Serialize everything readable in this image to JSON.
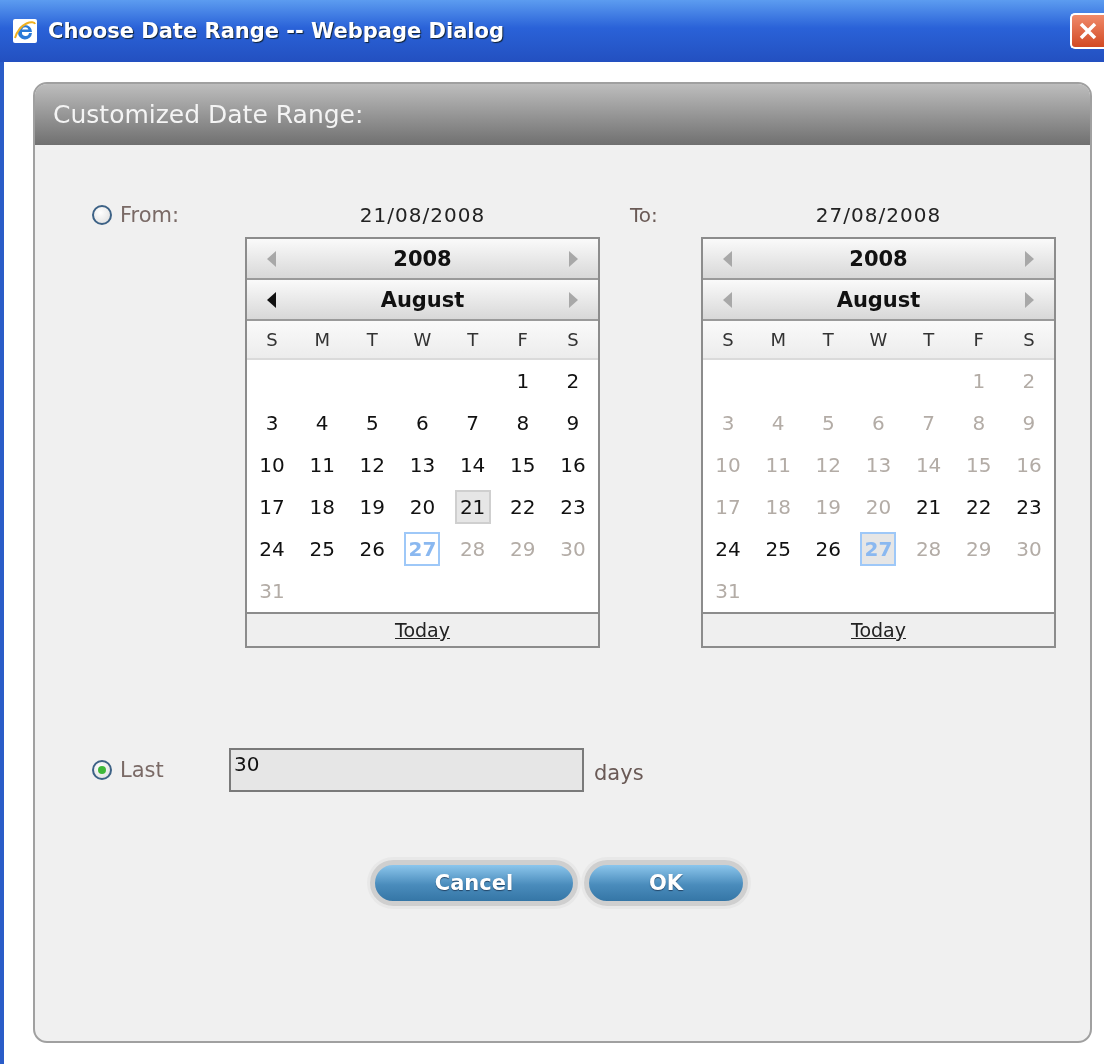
{
  "window": {
    "title": "Choose Date Range -- Webpage Dialog"
  },
  "panel": {
    "title": "Customized Date Range:"
  },
  "range": {
    "from_option": {
      "label": "From:",
      "selected": false
    },
    "to_label": "To:",
    "calendars": [
      {
        "date": "21/08/2008",
        "year": "2008",
        "year_prev_enabled": false,
        "year_next_enabled": false,
        "month": "August",
        "month_prev_enabled": true,
        "month_next_enabled": false,
        "weekdays": [
          "S",
          "M",
          "T",
          "W",
          "T",
          "F",
          "S"
        ],
        "today_link": "Today",
        "weeks": [
          [
            {
              "kind": "blank"
            },
            {
              "kind": "blank"
            },
            {
              "kind": "blank"
            },
            {
              "kind": "blank"
            },
            {
              "kind": "blank"
            },
            {
              "kind": "day",
              "text": "1",
              "enabled": true,
              "selected": false,
              "today": false
            },
            {
              "kind": "day",
              "text": "2",
              "enabled": true,
              "selected": false,
              "today": false
            }
          ],
          [
            {
              "kind": "day",
              "text": "3",
              "enabled": true,
              "selected": false,
              "today": false
            },
            {
              "kind": "day",
              "text": "4",
              "enabled": true,
              "selected": false,
              "today": false
            },
            {
              "kind": "day",
              "text": "5",
              "enabled": true,
              "selected": false,
              "today": false
            },
            {
              "kind": "day",
              "text": "6",
              "enabled": true,
              "selected": false,
              "today": false
            },
            {
              "kind": "day",
              "text": "7",
              "enabled": true,
              "selected": false,
              "today": false
            },
            {
              "kind": "day",
              "text": "8",
              "enabled": true,
              "selected": false,
              "today": false
            },
            {
              "kind": "day",
              "text": "9",
              "enabled": true,
              "selected": false,
              "today": false
            }
          ],
          [
            {
              "kind": "day",
              "text": "10",
              "enabled": true,
              "selected": false,
              "today": false
            },
            {
              "kind": "day",
              "text": "11",
              "enabled": true,
              "selected": false,
              "today": false
            },
            {
              "kind": "day",
              "text": "12",
              "enabled": true,
              "selected": false,
              "today": false
            },
            {
              "kind": "day",
              "text": "13",
              "enabled": true,
              "selected": false,
              "today": false
            },
            {
              "kind": "day",
              "text": "14",
              "enabled": true,
              "selected": false,
              "today": false
            },
            {
              "kind": "day",
              "text": "15",
              "enabled": true,
              "selected": false,
              "today": false
            },
            {
              "kind": "day",
              "text": "16",
              "enabled": true,
              "selected": false,
              "today": false
            }
          ],
          [
            {
              "kind": "day",
              "text": "17",
              "enabled": true,
              "selected": false,
              "today": false
            },
            {
              "kind": "day",
              "text": "18",
              "enabled": true,
              "selected": false,
              "today": false
            },
            {
              "kind": "day",
              "text": "19",
              "enabled": true,
              "selected": false,
              "today": false
            },
            {
              "kind": "day",
              "text": "20",
              "enabled": true,
              "selected": false,
              "today": false
            },
            {
              "kind": "day",
              "text": "21",
              "enabled": true,
              "selected": true,
              "today": false
            },
            {
              "kind": "day",
              "text": "22",
              "enabled": true,
              "selected": false,
              "today": false
            },
            {
              "kind": "day",
              "text": "23",
              "enabled": true,
              "selected": false,
              "today": false
            }
          ],
          [
            {
              "kind": "day",
              "text": "24",
              "enabled": true,
              "selected": false,
              "today": false
            },
            {
              "kind": "day",
              "text": "25",
              "enabled": true,
              "selected": false,
              "today": false
            },
            {
              "kind": "day",
              "text": "26",
              "enabled": true,
              "selected": false,
              "today": false
            },
            {
              "kind": "day",
              "text": "27",
              "enabled": true,
              "selected": false,
              "today": true
            },
            {
              "kind": "day",
              "text": "28",
              "enabled": false,
              "selected": false,
              "today": false
            },
            {
              "kind": "day",
              "text": "29",
              "enabled": false,
              "selected": false,
              "today": false
            },
            {
              "kind": "day",
              "text": "30",
              "enabled": false,
              "selected": false,
              "today": false
            }
          ],
          [
            {
              "kind": "day",
              "text": "31",
              "enabled": false,
              "selected": false,
              "today": false
            }
          ]
        ]
      },
      {
        "date": "27/08/2008",
        "year": "2008",
        "year_prev_enabled": false,
        "year_next_enabled": false,
        "month": "August",
        "month_prev_enabled": false,
        "month_next_enabled": false,
        "weekdays": [
          "S",
          "M",
          "T",
          "W",
          "T",
          "F",
          "S"
        ],
        "today_link": "Today",
        "weeks": [
          [
            {
              "kind": "blank"
            },
            {
              "kind": "blank"
            },
            {
              "kind": "blank"
            },
            {
              "kind": "blank"
            },
            {
              "kind": "blank"
            },
            {
              "kind": "day",
              "text": "1",
              "enabled": false,
              "selected": false,
              "today": false
            },
            {
              "kind": "day",
              "text": "2",
              "enabled": false,
              "selected": false,
              "today": false
            }
          ],
          [
            {
              "kind": "day",
              "text": "3",
              "enabled": false,
              "selected": false,
              "today": false
            },
            {
              "kind": "day",
              "text": "4",
              "enabled": false,
              "selected": false,
              "today": false
            },
            {
              "kind": "day",
              "text": "5",
              "enabled": false,
              "selected": false,
              "today": false
            },
            {
              "kind": "day",
              "text": "6",
              "enabled": false,
              "selected": false,
              "today": false
            },
            {
              "kind": "day",
              "text": "7",
              "enabled": false,
              "selected": false,
              "today": false
            },
            {
              "kind": "day",
              "text": "8",
              "enabled": false,
              "selected": false,
              "today": false
            },
            {
              "kind": "day",
              "text": "9",
              "enabled": false,
              "selected": false,
              "today": false
            }
          ],
          [
            {
              "kind": "day",
              "text": "10",
              "enabled": false,
              "selected": false,
              "today": false
            },
            {
              "kind": "day",
              "text": "11",
              "enabled": false,
              "selected": false,
              "today": false
            },
            {
              "kind": "day",
              "text": "12",
              "enabled": false,
              "selected": false,
              "today": false
            },
            {
              "kind": "day",
              "text": "13",
              "enabled": false,
              "selected": false,
              "today": false
            },
            {
              "kind": "day",
              "text": "14",
              "enabled": false,
              "selected": false,
              "today": false
            },
            {
              "kind": "day",
              "text": "15",
              "enabled": false,
              "selected": false,
              "today": false
            },
            {
              "kind": "day",
              "text": "16",
              "enabled": false,
              "selected": false,
              "today": false
            }
          ],
          [
            {
              "kind": "day",
              "text": "17",
              "enabled": false,
              "selected": false,
              "today": false
            },
            {
              "kind": "day",
              "text": "18",
              "enabled": false,
              "selected": false,
              "today": false
            },
            {
              "kind": "day",
              "text": "19",
              "enabled": false,
              "selected": false,
              "today": false
            },
            {
              "kind": "day",
              "text": "20",
              "enabled": false,
              "selected": false,
              "today": false
            },
            {
              "kind": "day",
              "text": "21",
              "enabled": true,
              "selected": false,
              "today": false
            },
            {
              "kind": "day",
              "text": "22",
              "enabled": true,
              "selected": false,
              "today": false
            },
            {
              "kind": "day",
              "text": "23",
              "enabled": true,
              "selected": false,
              "today": false
            }
          ],
          [
            {
              "kind": "day",
              "text": "24",
              "enabled": true,
              "selected": false,
              "today": false
            },
            {
              "kind": "day",
              "text": "25",
              "enabled": true,
              "selected": false,
              "today": false
            },
            {
              "kind": "day",
              "text": "26",
              "enabled": true,
              "selected": false,
              "today": false
            },
            {
              "kind": "day",
              "text": "27",
              "enabled": true,
              "selected": true,
              "today": true
            },
            {
              "kind": "day",
              "text": "28",
              "enabled": false,
              "selected": false,
              "today": false
            },
            {
              "kind": "day",
              "text": "29",
              "enabled": false,
              "selected": false,
              "today": false
            },
            {
              "kind": "day",
              "text": "30",
              "enabled": false,
              "selected": false,
              "today": false
            }
          ],
          [
            {
              "kind": "day",
              "text": "31",
              "enabled": false,
              "selected": false,
              "today": false
            }
          ]
        ]
      }
    ]
  },
  "last": {
    "option": {
      "label": "Last",
      "selected": true
    },
    "value": "30",
    "unit": "days"
  },
  "buttons": [
    {
      "label": "Cancel"
    },
    {
      "label": "OK"
    }
  ]
}
